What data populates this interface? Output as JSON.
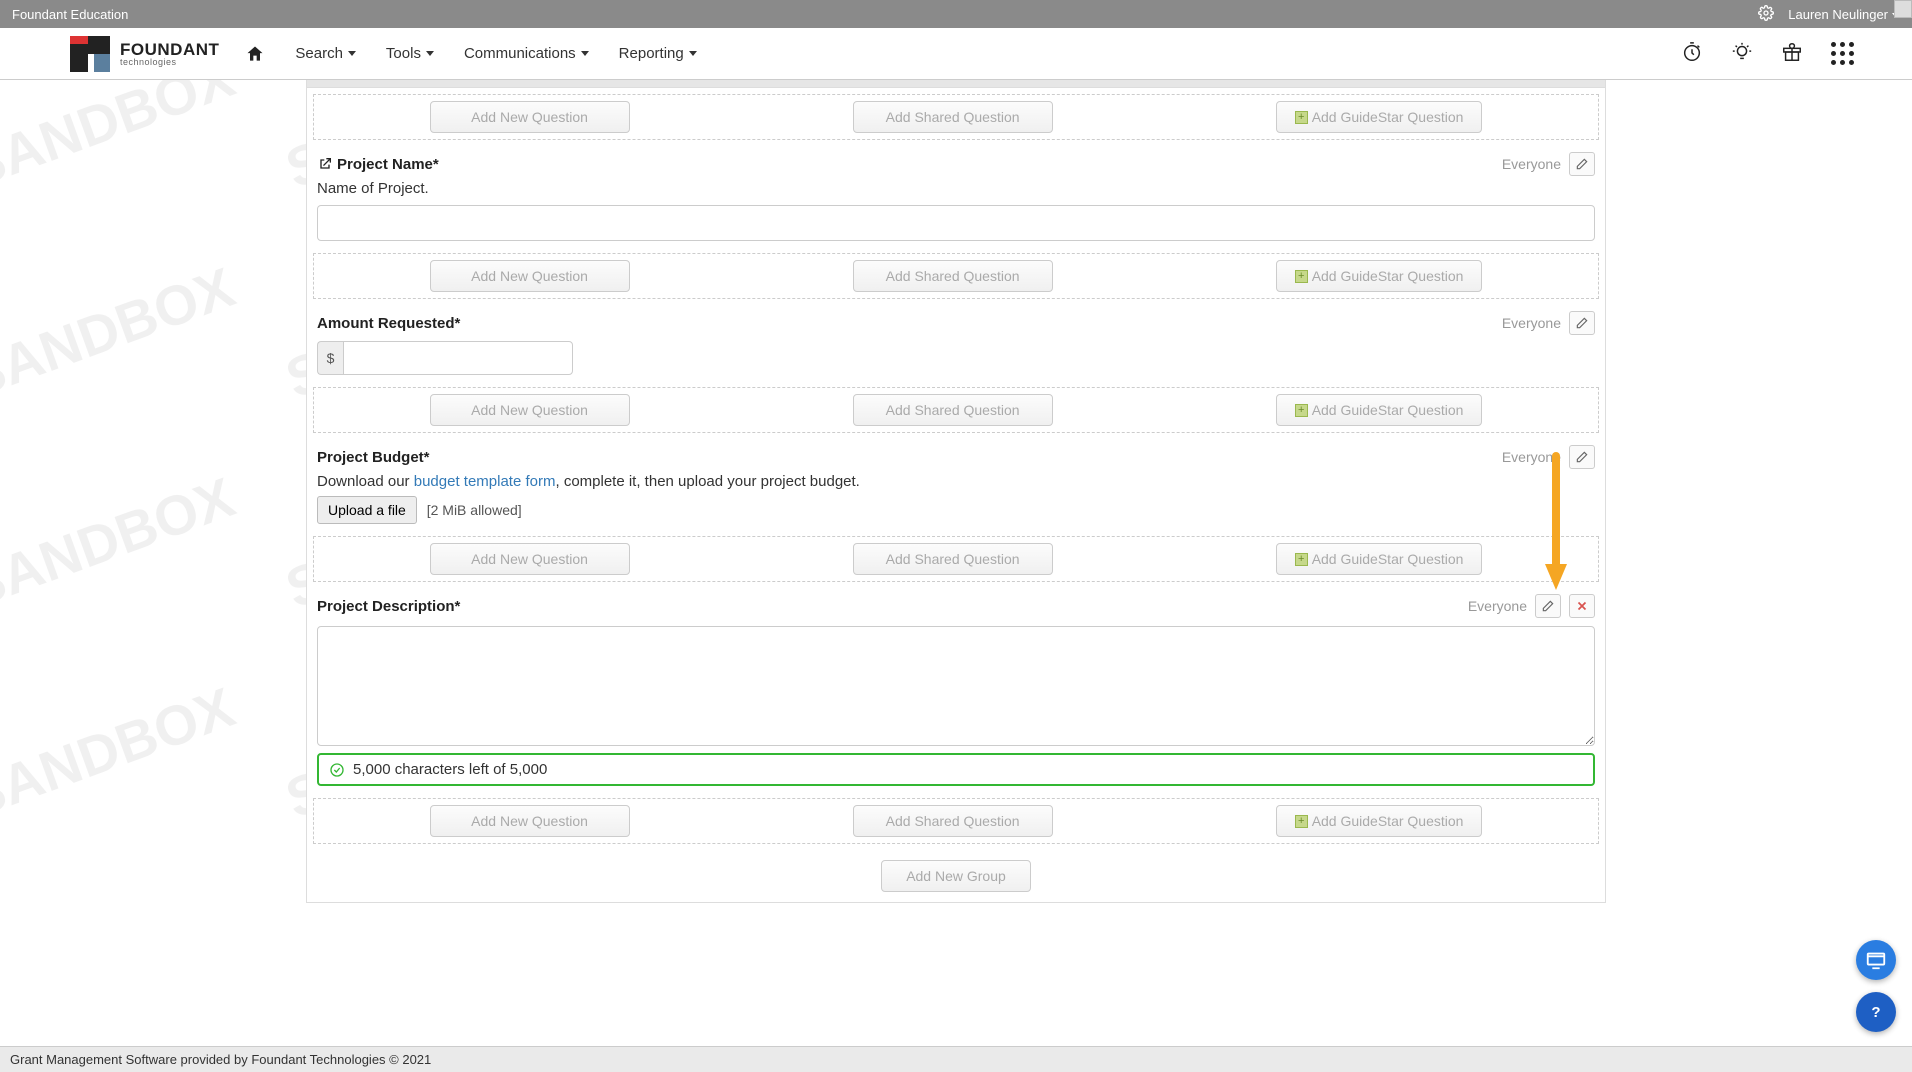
{
  "watermark_text": "SANDBOX",
  "topbar": {
    "site": "Foundant Education",
    "user": "Lauren Neulinger"
  },
  "logo": {
    "big": "FOUNDANT",
    "small": "technologies"
  },
  "nav": {
    "home": "Home",
    "items": [
      "Search",
      "Tools",
      "Communications",
      "Reporting"
    ]
  },
  "buttons": {
    "add_new": "Add New Question",
    "add_shared": "Add Shared Question",
    "add_gs": "Add GuideStar Question",
    "add_group": "Add New Group",
    "upload": "Upload a file"
  },
  "visibility": "Everyone",
  "questions": {
    "project_name": {
      "label": "Project Name*",
      "sub": "Name of Project."
    },
    "amount_requested": {
      "label": "Amount Requested*",
      "prefix": "$"
    },
    "project_budget": {
      "label": "Project Budget*",
      "sub_pre": "Download our ",
      "sub_link": "budget template form",
      "sub_post": ", complete it, then upload your project budget.",
      "upload_note": "[2 MiB allowed]"
    },
    "project_description": {
      "label": "Project Description*",
      "char_counter": "5,000 characters left of 5,000"
    }
  },
  "footer": "Grant Management Software provided by Foundant Technologies © 2021"
}
